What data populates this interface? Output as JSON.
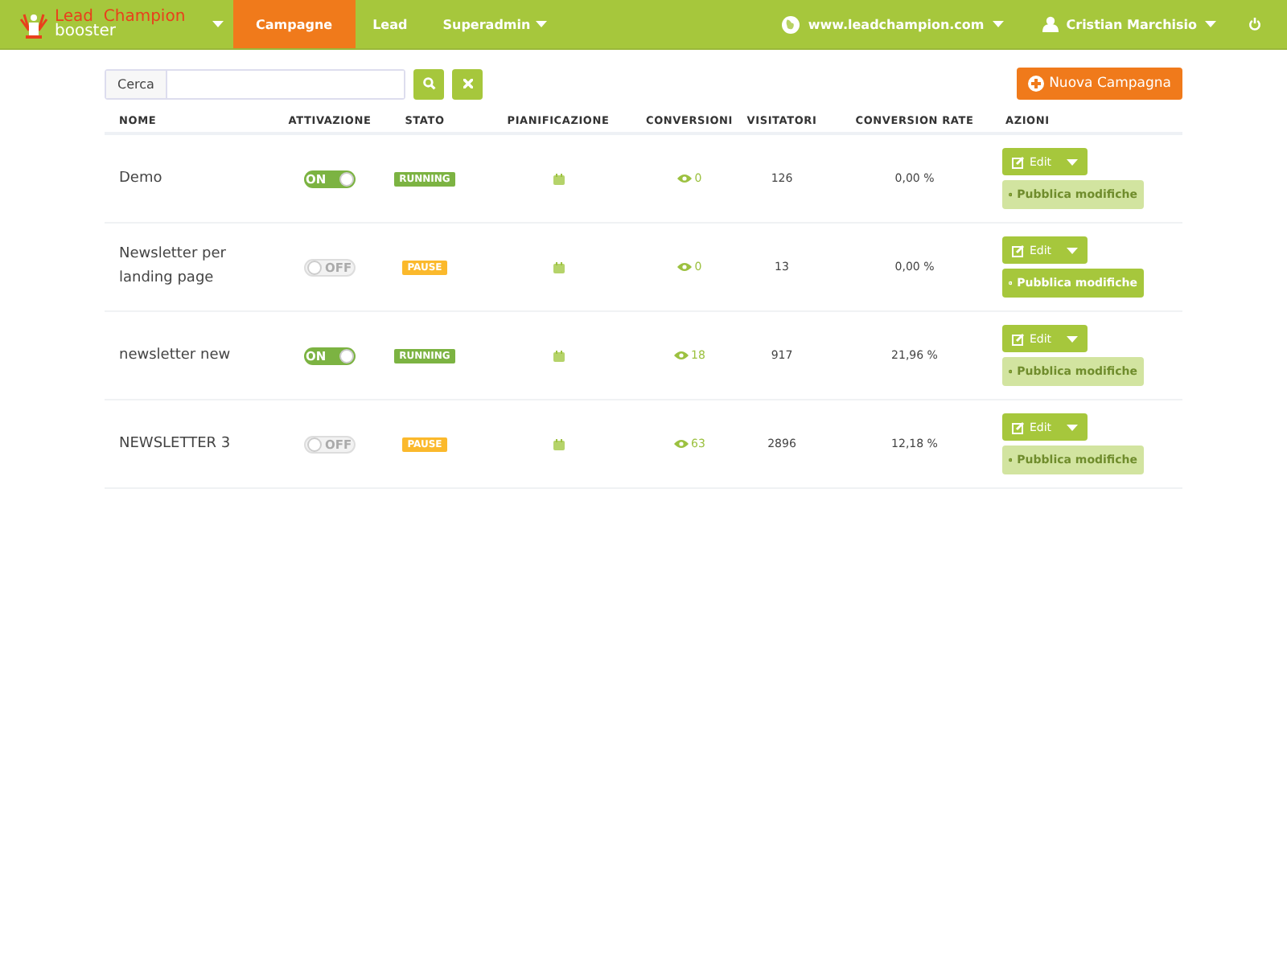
{
  "navbar": {
    "brand_line1": "Lead  Champion",
    "brand_line2": "booster",
    "menu": [
      {
        "label": "Campagne",
        "selected": true,
        "dropdown": false
      },
      {
        "label": "Lead",
        "selected": false,
        "dropdown": false
      },
      {
        "label": "Superadmin",
        "selected": false,
        "dropdown": true
      }
    ],
    "site": "www.leadchampion.com",
    "user": "Cristian Marchisio"
  },
  "search": {
    "label": "Cerca"
  },
  "new_button": "Nuova Campagna",
  "table": {
    "columns": [
      "NOME",
      "ATTIVAZIONE",
      "STATO",
      "PIANIFICAZIONE",
      "CONVERSIONI",
      "VISITATORI",
      "CONVERSION RATE",
      "AZIONI"
    ],
    "rows": [
      {
        "name": "Demo",
        "on": true,
        "toggle_label": "ON",
        "status": {
          "label": "RUNNING",
          "kind": "running"
        },
        "conversions": "0",
        "visitors": "126",
        "rate": "0,00 %",
        "edit": "Edit",
        "publish": "Pubblica modifiche",
        "publish_disabled": true
      },
      {
        "name": "Newsletter per landing page",
        "on": false,
        "toggle_label": "OFF",
        "status": {
          "label": "PAUSE",
          "kind": "pause"
        },
        "conversions": "0",
        "visitors": "13",
        "rate": "0,00 %",
        "edit": "Edit",
        "publish": "Pubblica modifiche",
        "publish_disabled": false
      },
      {
        "name": "newsletter new",
        "on": true,
        "toggle_label": "ON",
        "status": {
          "label": "RUNNING",
          "kind": "running"
        },
        "conversions": "18",
        "visitors": "917",
        "rate": "21,96 %",
        "edit": "Edit",
        "publish": "Pubblica modifiche",
        "publish_disabled": true
      },
      {
        "name": "NEWSLETTER 3",
        "on": false,
        "toggle_label": "OFF",
        "status": {
          "label": "PAUSE",
          "kind": "pause"
        },
        "conversions": "63",
        "visitors": "2896",
        "rate": "12,18 %",
        "edit": "Edit",
        "publish": "Pubblica modifiche",
        "publish_disabled": true
      }
    ]
  }
}
